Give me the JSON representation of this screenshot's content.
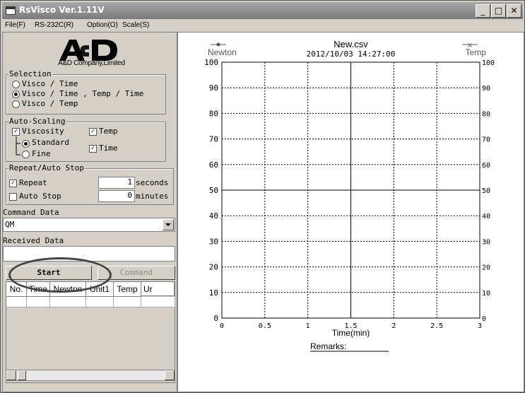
{
  "window": {
    "title": "RsVisco Ver.1.11V"
  },
  "menu": [
    {
      "label": "File(F)"
    },
    {
      "label": "RS-232C(R)"
    },
    {
      "label": "Option(O)"
    },
    {
      "label": "Scale(S)"
    }
  ],
  "logo": {
    "sub": "A&D Company,Limited"
  },
  "selection": {
    "title": "Selection",
    "options": [
      "Visco / Time",
      "Visco / Time , Temp / Time",
      "Visco / Temp"
    ],
    "selected_index": 1
  },
  "auto_scaling": {
    "title": "Auto-Scaling",
    "viscosity": "Viscosity",
    "temp": "Temp",
    "standard": "Standard",
    "fine": "Fine",
    "time": "Time"
  },
  "repeat": {
    "title": "Repeat/Auto Stop",
    "repeat_label": "Repeat",
    "repeat_value": "1",
    "seconds": "seconds",
    "auto_stop_label": "Auto Stop",
    "auto_stop_value": "0",
    "minutes": "minutes"
  },
  "command": {
    "label": "Command Data",
    "value": "QM"
  },
  "received": {
    "label": "Received Data",
    "value": ""
  },
  "buttons": {
    "start": "Start",
    "command": "Command"
  },
  "table": {
    "columns": [
      "No.",
      "Time",
      "Newton",
      "Unit1",
      "Temp",
      "Ur"
    ]
  },
  "chart_data": {
    "type": "line",
    "title": "New.csv",
    "timestamp": "2012/10/03 14:27:00",
    "left_axis_label": "Newton",
    "right_axis_label": "Temp",
    "xlabel": "Time(min)",
    "x_ticks": [
      "0",
      "0.5",
      "1",
      "1.5",
      "2",
      "2.5",
      "3"
    ],
    "y_ticks": [
      "0",
      "10",
      "20",
      "30",
      "40",
      "50",
      "60",
      "70",
      "80",
      "90",
      "100"
    ],
    "xlim": [
      0,
      3
    ],
    "ylim": [
      0,
      100
    ],
    "grid": true,
    "series": [],
    "remarks_label": "Remarks:"
  }
}
